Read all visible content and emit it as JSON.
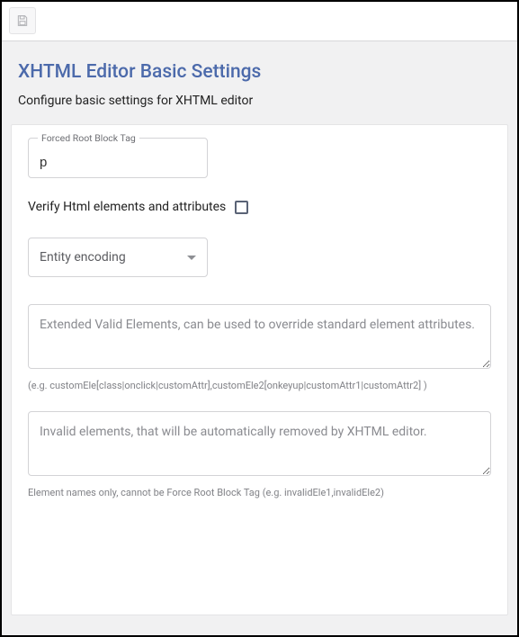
{
  "header": {
    "title": "XHTML Editor Basic Settings",
    "subtitle": "Configure basic settings for XHTML editor"
  },
  "toolbar": {
    "save_icon": "save"
  },
  "form": {
    "root_block": {
      "label": "Forced Root Block Tag",
      "value": "p"
    },
    "verify": {
      "label": "Verify Html elements and attributes",
      "checked": false
    },
    "entity_encoding": {
      "selected": "Entity encoding"
    },
    "extended_valid": {
      "placeholder": "Extended Valid Elements, can be used to override standard element attributes.",
      "hint": "(e.g. customEle[class|onclick|customAttr],customEle2[onkeyup|customAttr1|customAttr2] )",
      "value": ""
    },
    "invalid_elements": {
      "placeholder": "Invalid elements, that will be automatically removed by XHTML editor.",
      "hint": "Element names only, cannot be Force Root Block Tag (e.g. invalidEle1,invalidEle2)",
      "value": ""
    }
  }
}
